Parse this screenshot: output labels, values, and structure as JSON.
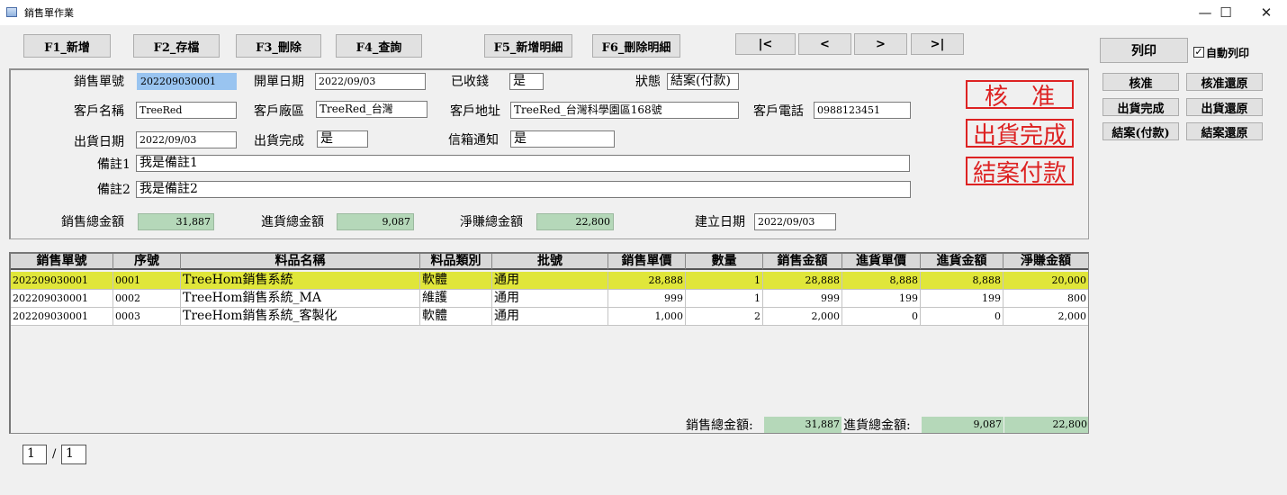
{
  "window": {
    "title": "銷售單作業",
    "minimize": "—",
    "maximize": "☐",
    "close": "✕"
  },
  "toolbar": {
    "add": "F1_新增",
    "save": "F2_存檔",
    "delete": "F3_刪除",
    "query": "F4_查詢",
    "add_detail": "F5_新增明細",
    "delete_detail": "F6_刪除明細",
    "first": "|<",
    "prev": "<",
    "next": ">",
    "last": ">|"
  },
  "side": {
    "print": "列印",
    "auto_print": "自動列印",
    "auto_print_checked": true,
    "approve": "核准",
    "approve_revert": "核准還原",
    "ship_done": "出貨完成",
    "ship_revert": "出貨還原",
    "close_paid": "結案(付款)",
    "close_revert": "結案還原"
  },
  "form": {
    "order_no_label": "銷售單號",
    "order_no": "202209030001",
    "open_date_label": "開單日期",
    "open_date": "2022/09/03",
    "received_label": "已收錢",
    "received": "是",
    "status_label": "狀態",
    "status": "結案(付款)",
    "customer_label": "客戶名稱",
    "customer": "TreeRed",
    "factory_label": "客戶廠區",
    "factory": "TreeRed_台灣",
    "address_label": "客戶地址",
    "address": "TreeRed_台灣科學園區168號",
    "phone_label": "客戶電話",
    "phone": "0988123451",
    "ship_date_label": "出貨日期",
    "ship_date": "2022/09/03",
    "ship_done_label": "出貨完成",
    "ship_done": "是",
    "mail_label": "信箱通知",
    "mail": "是",
    "note1_label": "備註1",
    "note1": "我是備註1",
    "note2_label": "備註2",
    "note2": "我是備註2",
    "sales_total_label": "銷售總金額",
    "sales_total": "31,887",
    "purchase_total_label": "進貨總金額",
    "purchase_total": "9,087",
    "profit_total_label": "淨賺總金額",
    "profit_total": "22,800",
    "created_label": "建立日期",
    "created": "2022/09/03"
  },
  "stamps": {
    "approved": "核　准",
    "shipped": "出貨完成",
    "closed": "結案付款",
    "color": "#dd2222"
  },
  "grid": {
    "columns": [
      "銷售單號",
      "序號",
      "料品名稱",
      "料品類別",
      "批號",
      "銷售單價",
      "數量",
      "銷售金額",
      "進貨單價",
      "進貨金額",
      "淨賺金額"
    ],
    "rows": [
      [
        "202209030001",
        "0001",
        "TreeHom銷售系統",
        "軟體",
        "通用",
        "28,888",
        "1",
        "28,888",
        "8,888",
        "8,888",
        "20,000"
      ],
      [
        "202209030001",
        "0002",
        "TreeHom銷售系統_MA",
        "維護",
        "通用",
        "999",
        "1",
        "999",
        "199",
        "199",
        "800"
      ],
      [
        "202209030001",
        "0003",
        "TreeHom銷售系統_客製化",
        "軟體",
        "通用",
        "1,000",
        "2",
        "2,000",
        "0",
        "0",
        "2,000"
      ]
    ],
    "selected_row_color": "#e0e63a",
    "sum_sales_label": "銷售總金額:",
    "sum_sales": "31,887",
    "sum_purchase_label": "進貨總金額:",
    "sum_purchase": "9,087",
    "sum_profit": "22,800"
  },
  "pager": {
    "current": "1",
    "separator": "/",
    "total": "1"
  }
}
